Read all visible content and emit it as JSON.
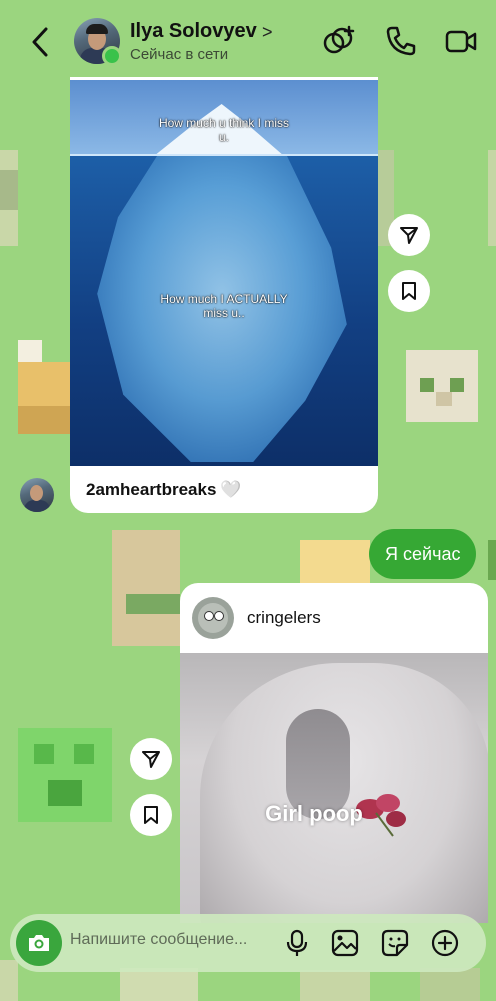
{
  "header": {
    "name": "Ilya Solovyev",
    "chevron": ">",
    "status": "Сейчас в сети"
  },
  "post1": {
    "image_top_text": "How much u think I miss u.",
    "image_bottom_text": "How much I ACTUALLY miss u..",
    "username": "2amheartbreaks",
    "heart": "🤍"
  },
  "my_message": "Я сейчас",
  "post2": {
    "username": "cringelers",
    "image_text": "Girl poop"
  },
  "composer": {
    "placeholder": "Напишите сообщение..."
  },
  "colors": {
    "background": "#9bd57f",
    "accent": "#36a834",
    "online": "#39c24a"
  },
  "icons": [
    "back-icon",
    "ai-chat-icon",
    "phone-icon",
    "video-icon",
    "send-icon",
    "bookmark-icon",
    "camera-icon",
    "microphone-icon",
    "gallery-icon",
    "sticker-icon",
    "plus-icon"
  ]
}
